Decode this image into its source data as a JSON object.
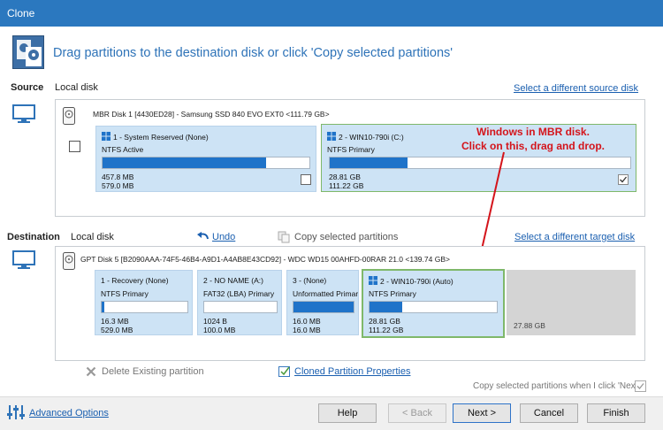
{
  "window": {
    "title": "Clone"
  },
  "header": {
    "instruction": "Drag partitions to the destination disk or click 'Copy selected partitions'"
  },
  "source": {
    "label": "Source",
    "disk_type": "Local disk",
    "select_link": "Select a different source disk",
    "disk_info": "MBR Disk 1 [4430ED28] - Samsung  SSD 840 EVO     EXT0  <111.79 GB>",
    "partitions": [
      {
        "name": "1 - System Reserved (None)",
        "fs": "NTFS Active",
        "used": "457.8 MB",
        "total": "579.0 MB",
        "fill_percent": 79,
        "checked": false
      },
      {
        "name": "2 - WIN10-790i (C:)",
        "fs": "NTFS Primary",
        "used": "28.81 GB",
        "total": "111.22 GB",
        "fill_percent": 26,
        "checked": true
      }
    ]
  },
  "annotation": {
    "line1": "Windows in MBR disk.",
    "line2": "Click on this, drag and drop."
  },
  "destination": {
    "label": "Destination",
    "disk_type": "Local disk",
    "undo_label": "Undo",
    "copy_label": "Copy selected partitions",
    "select_link": "Select a different target disk",
    "disk_info": "GPT Disk 5 [B2090AAA-74F5-46B4-A9D1-A4AB8E43CD92] - WDC WD15 00AHFD-00RAR     21.0  <139.74 GB>",
    "partitions": [
      {
        "name": "1 - Recovery (None)",
        "fs": "NTFS Primary",
        "used": "16.3 MB",
        "total": "529.0 MB",
        "fill_percent": 3
      },
      {
        "name": "2 - NO NAME (A:)",
        "fs": "FAT32 (LBA) Primary",
        "used": "1024 B",
        "total": "100.0 MB",
        "fill_percent": 0
      },
      {
        "name": "3 - (None)",
        "fs": "Unformatted Primar",
        "used": "16.0 MB",
        "total": "16.0 MB",
        "fill_percent": 100
      },
      {
        "name": "2 - WIN10-790i (Auto)",
        "fs": "NTFS Primary",
        "used": "28.81 GB",
        "total": "111.22 GB",
        "fill_percent": 26
      }
    ],
    "unallocated": "27.88 GB"
  },
  "actions": {
    "delete_label": "Delete Existing partition",
    "properties_label": "Cloned Partition Properties",
    "copy_when_next": "Copy selected partitions when I click 'Next'"
  },
  "footer": {
    "advanced_label": "Advanced Options",
    "help": "Help",
    "back": "< Back",
    "next": "Next >",
    "cancel": "Cancel",
    "finish": "Finish"
  },
  "colors": {
    "title_bar": "#2b78bf",
    "partition_bg": "#cde3f5",
    "bar_fill": "#1f73c9",
    "annotation": "#d4141b",
    "link": "#1a5fb0"
  }
}
